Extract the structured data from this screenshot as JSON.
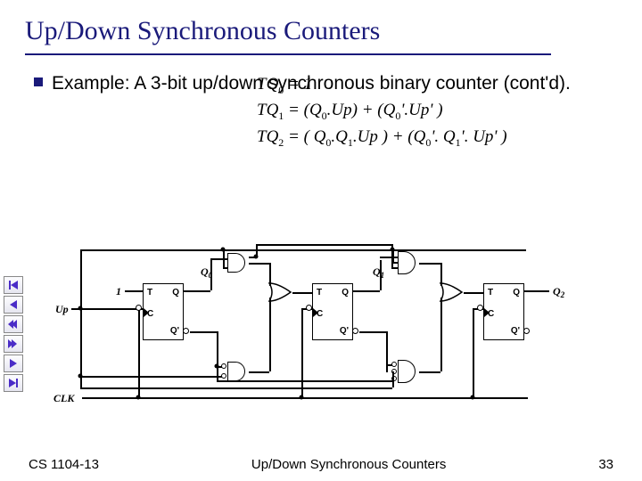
{
  "title": "Up/Down Synchronous Counters",
  "bullet": "Example: A 3-bit up/down synchronous binary counter (cont'd).",
  "eq0_l": "TQ",
  "eq0_s": "0",
  "eq0_r": " = 1",
  "eq1_l": "TQ",
  "eq1_s": "1",
  "eq1_r": " = (Q",
  "eq1_s2": "0",
  "eq1_r2": ".Up) + (Q",
  "eq1_s3": "0",
  "eq1_r3": "'.Up' )",
  "eq2_l": "TQ",
  "eq2_s": "2",
  "eq2_r": " = ( Q",
  "eq2_s2": "0",
  "eq2_r2": ".Q",
  "eq2_s3": "1",
  "eq2_r3": ".Up ) + (Q",
  "eq2_s4": "0",
  "eq2_r4": "'. Q",
  "eq2_s5": "1",
  "eq2_r5": "'. Up' )",
  "signals": {
    "one": "1",
    "up": "Up",
    "clk": "CLK"
  },
  "ff": {
    "t": "T",
    "c": "C",
    "q": "Q",
    "qp": "Q'"
  },
  "outs": {
    "q0": "Q",
    "q0s": "0",
    "q1": "Q",
    "q1s": "1",
    "q2": "Q",
    "q2s": "2"
  },
  "footer": {
    "left": "CS 1104-13",
    "center": "Up/Down Synchronous Counters",
    "right": "33"
  }
}
